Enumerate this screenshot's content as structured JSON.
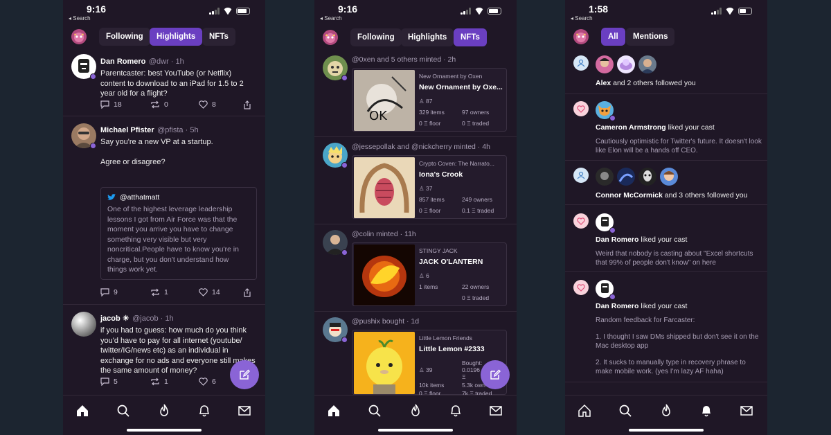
{
  "screens": [
    {
      "time": "9:16",
      "back": "◂ Search",
      "tabs": [
        "Following",
        "Highlights",
        "NFTs"
      ],
      "active_tab": "Highlights",
      "posts": [
        {
          "name": "Dan Romero",
          "handle": "@dwr · 1h",
          "text": "Parentcaster: best YouTube (or Netflix) content to download to an iPad for 1.5 to 2 year old for a flight?",
          "replies": "18",
          "recasts": "0",
          "likes": "8"
        },
        {
          "name": "Michael Pfister",
          "handle": "@pfista · 5h",
          "text": "Say you're a new VP at a startup.",
          "text2": "Agree or disagree?",
          "quote_handle": "@atthatmatt",
          "quote_text": "One of the highest leverage leadership lessons I got from Air Force was that the moment you arrive you have to change something very visible but very noncritical.People have to know you're in charge, but you don't understand how things work yet.",
          "replies": "9",
          "recasts": "1",
          "likes": "14"
        },
        {
          "name": "jacob ☀",
          "handle": "@jacob · 1h",
          "text": "if you had to guess: how much do you think you'd have to pay for all internet (youtube/ twitter/IG/news etc) as an individual in exchange for no ads and everyone still makes the same amount of money?",
          "replies": "5",
          "recasts": "1",
          "likes": "6"
        }
      ]
    },
    {
      "time": "9:16",
      "back": "◂ Search",
      "tabs": [
        "Following",
        "Highlights",
        "NFTs"
      ],
      "active_tab": "NFTs",
      "mints": [
        {
          "header": "@0xen and 5 others minted · 2h",
          "collection": "New Ornament by Oxen",
          "name": "New Ornament by Oxe...",
          "holders": "87",
          "items": "329 items",
          "owners": "97 owners",
          "floor": "0 Ξ floor",
          "traded": "0 Ξ traded"
        },
        {
          "header": "@jessepollak and @nickcherry minted · 4h",
          "collection": "Crypto Coven: The Narrato...",
          "name": "Iona's Crook",
          "holders": "37",
          "items": "857 items",
          "owners": "249 owners",
          "floor": "0 Ξ floor",
          "traded": "0.1 Ξ traded"
        },
        {
          "header": "@colin minted · 11h",
          "collection": "STINGY JACK",
          "name": "JACK O'LANTERN",
          "holders": "6",
          "items": "1 items",
          "owners": "22 owners",
          "floor": "",
          "traded": "0 Ξ traded"
        },
        {
          "header": "@pushix bought · 1d",
          "collection": "Little Lemon Friends",
          "name": "Little Lemon #2333",
          "holders": "39",
          "bought": "Bought:",
          "bought_value": "0.0196",
          "bought_unit": "Ξ",
          "items": "10k items",
          "owners": "5.3k own",
          "floor": "0 Ξ floor",
          "traded": "7k Ξ traded"
        }
      ]
    },
    {
      "time": "1:58",
      "back": "◂ Search",
      "tabs": [
        "All",
        "Mentions"
      ],
      "active_tab": "All",
      "notifications": [
        {
          "kind": "follow",
          "actor": "Alex",
          "rest": " and 2 others followed you"
        },
        {
          "kind": "like",
          "actor": "Cameron Armstrong",
          "rest": " liked your cast",
          "cast": "Cautiously optimistic for Twitter's future. It doesn't look like Elon will be a hands off CEO."
        },
        {
          "kind": "follow",
          "actor": "Connor McCormick",
          "rest": " and 3 others followed you"
        },
        {
          "kind": "like",
          "actor": "Dan Romero",
          "rest": " liked your cast",
          "cast": "Weird that nobody is casting about \"Excel shortcuts that 99% of people don't know\" on here"
        },
        {
          "kind": "like",
          "actor": "Dan Romero",
          "rest": " liked your cast",
          "cast": "Random feedback for Farcaster:",
          "cast2": "1. I thought I saw DMs shipped but don't see it on the Mac desktop app",
          "cast3": "2. It sucks to manually type in recovery phrase to make mobile work. (yes I'm lazy AF haha)"
        }
      ]
    }
  ],
  "nav_icons": [
    "home-icon",
    "search-icon",
    "flame-icon",
    "bell-icon",
    "mail-icon"
  ],
  "colors": {
    "background": "#1c2530",
    "phone": "#1f1726",
    "accent": "#6a3fc1",
    "fab": "#8a64d6"
  }
}
